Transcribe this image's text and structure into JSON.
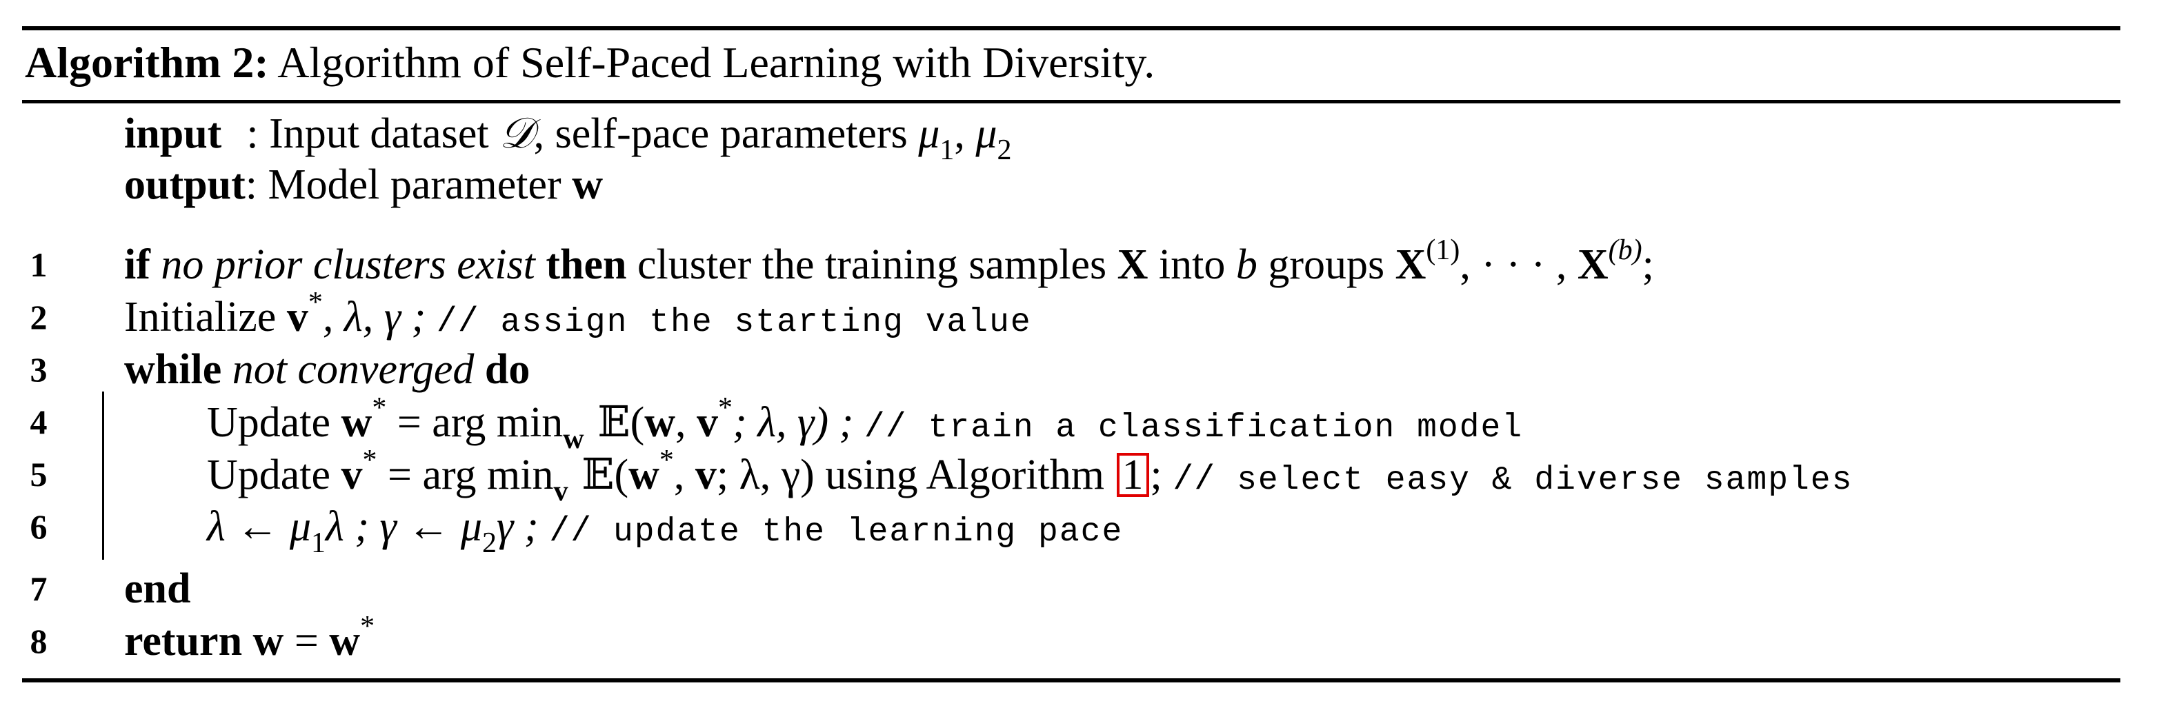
{
  "algorithm": {
    "label": "Algorithm 2:",
    "title": "Algorithm of Self-Paced Learning with Diversity."
  },
  "io": {
    "input_kw": "input",
    "input_sep": ":",
    "input_text_pre": "Input dataset ",
    "input_symbol_D": "𝒟",
    "input_text_post": ", self-pace parameters ",
    "input_mu1": "μ",
    "input_mu1_sub": "1",
    "input_comma": ", ",
    "input_mu2": "μ",
    "input_mu2_sub": "2",
    "output_kw": "output",
    "output_sep": ":",
    "output_text": "Model parameter ",
    "output_symbol": "w"
  },
  "lines": [
    {
      "num": "1",
      "if_kw": "if",
      "cond": "no prior clusters exist",
      "then_kw": "then",
      "text1": "cluster the training samples ",
      "X": "X",
      "text2": " into ",
      "b": "b",
      "text3": " groups ",
      "X1": "X",
      "X1_sup": "(1)",
      "dots": ", · · · , ",
      "Xb": "X",
      "Xb_sup": "(b)",
      "end": ";"
    },
    {
      "num": "2",
      "text": "Initialize ",
      "v": "v",
      "vstar": "*",
      "rest": ", λ, γ ; ",
      "comment_mark": "//",
      "comment": " assign the starting value"
    },
    {
      "num": "3",
      "while_kw": "while",
      "cond": "not converged",
      "do_kw": "do"
    },
    {
      "num": "4",
      "text": "Update ",
      "w": "w",
      "wstar": "*",
      "eq": " = arg min",
      "min_sub": "w",
      "E": " 𝔼",
      "args_pre": "(",
      "args_w": "w",
      "args_mid": ", ",
      "args_v": "v",
      "args_vstar": "*",
      "args_post": "; λ, γ) ; ",
      "comment_mark": "//",
      "comment": " train a classification model"
    },
    {
      "num": "5",
      "text": "Update ",
      "v": "v",
      "vstar": "*",
      "eq": " = arg min",
      "min_sub": "v",
      "E": " 𝔼",
      "args_pre": "(",
      "args_w": "w",
      "args_wstar": "*",
      "args_mid": ", ",
      "args_v": "v",
      "args_post": "; λ, γ) using Algorithm ",
      "ref": "1",
      "end": "; ",
      "comment_mark": "//",
      "comment": " select easy & diverse samples"
    },
    {
      "num": "6",
      "l1": "λ ← μ",
      "l1_sub": "1",
      "l2": "λ ; γ ← μ",
      "l2_sub": "2",
      "l3": "γ ; ",
      "comment_mark": "//",
      "comment": " update the learning pace"
    },
    {
      "num": "7",
      "end_kw": "end"
    },
    {
      "num": "8",
      "return_kw": "return",
      "w": "w",
      "eq": " = ",
      "w2": "w",
      "w2star": "*"
    }
  ]
}
